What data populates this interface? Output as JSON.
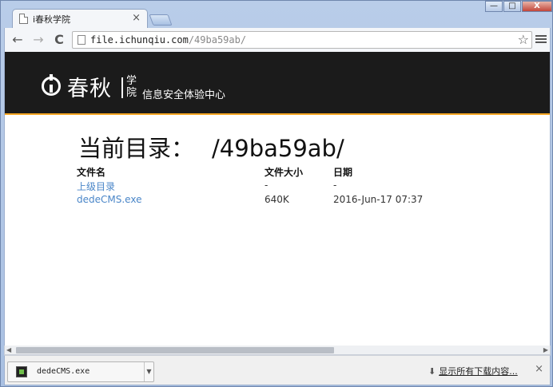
{
  "window": {
    "tab_title": "i春秋学院",
    "tab_close": "×",
    "minimize": "—",
    "maximize": "□",
    "close": "X"
  },
  "toolbar": {
    "back": "←",
    "forward": "→",
    "reload": "C",
    "url_host": "file.ichunqiu.com",
    "url_path": "/49ba59ab/",
    "star": "☆"
  },
  "banner": {
    "logo_name": "春秋",
    "logo_xue": "学院",
    "logo_sub": "信息安全体验中心"
  },
  "listing": {
    "title_label": "当前目录：",
    "title_path": "/49ba59ab/",
    "headers": {
      "name": "文件名",
      "size": "文件大小",
      "date": "日期"
    },
    "rows": [
      {
        "name": "上级目录",
        "size": "-",
        "date": "-"
      },
      {
        "name": "dedeCMS.exe",
        "size": "640K",
        "date": "2016-Jun-17 07:37"
      }
    ]
  },
  "downloads": {
    "item_name": "dedeCMS.exe",
    "show_all": "显示所有下载内容...",
    "close": "×"
  },
  "colors": {
    "link": "#4a86c8",
    "banner_bg": "#1b1b1b",
    "banner_accent": "#f5a623"
  }
}
